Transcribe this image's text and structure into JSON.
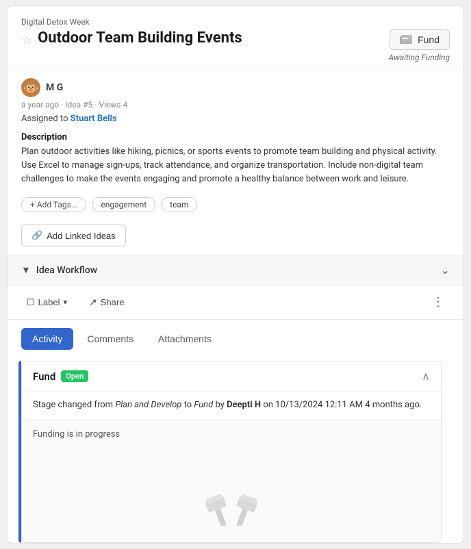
{
  "app": {
    "category": "Digital Detox Week",
    "title": "Outdoor Team Building Events",
    "fund_button_label": "Fund",
    "awaiting_label": "Awaiting Funding",
    "author_initial": "🐵",
    "author_name": "M G",
    "meta": "a year ago  ·  Idea #5  ·  Views 4",
    "assigned_prefix": "Assigned to",
    "assigned_name": "Stuart Bells",
    "description_title": "Description",
    "description_text": "Plan outdoor activities like hiking, picnics, or sports events to promote team building and physical activity. Use Excel to manage sign-ups, track attendance, and organize transportation. Include non-digital team challenges to make the events engaging and promote a healthy balance between work and leisure.",
    "tags": [
      "+ Add Tags...",
      "engagement",
      "team"
    ],
    "linked_ideas_label": "Add 🔗 Linked Ideas",
    "workflow_label": "Idea Workflow",
    "action_label": "Label",
    "share_label": "Share",
    "tabs": [
      {
        "id": "activity",
        "label": "Activity",
        "active": true
      },
      {
        "id": "comments",
        "label": "Comments",
        "active": false
      },
      {
        "id": "attachments",
        "label": "Attachments",
        "active": false
      }
    ],
    "activity": {
      "card_title": "Fund",
      "badge_label": "Open",
      "stage_from": "Plan and Develop",
      "stage_to": "Fund",
      "changed_by": "Deepti H",
      "changed_date": "on 10/13/2024 12:11 AM 4 months ago.",
      "note_text": "Funding is in progress"
    }
  }
}
